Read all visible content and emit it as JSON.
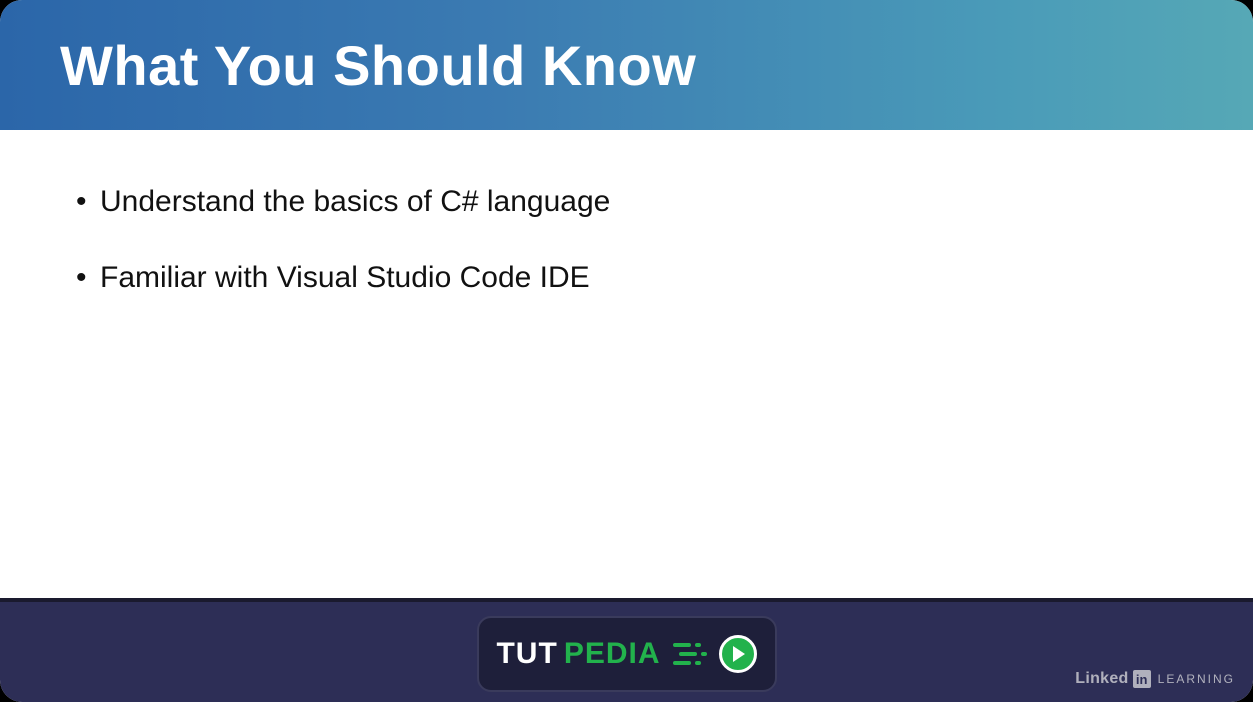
{
  "header": {
    "title": "What You Should Know"
  },
  "content": {
    "bullets": [
      "Understand the basics of C# language",
      "Familiar with Visual Studio Code IDE"
    ]
  },
  "footer": {
    "center_logo": {
      "part1": "TUT",
      "part2": "PEDIA"
    },
    "right_badge": {
      "linked": "Linked",
      "in": "in",
      "learning": "LEARNING"
    }
  }
}
